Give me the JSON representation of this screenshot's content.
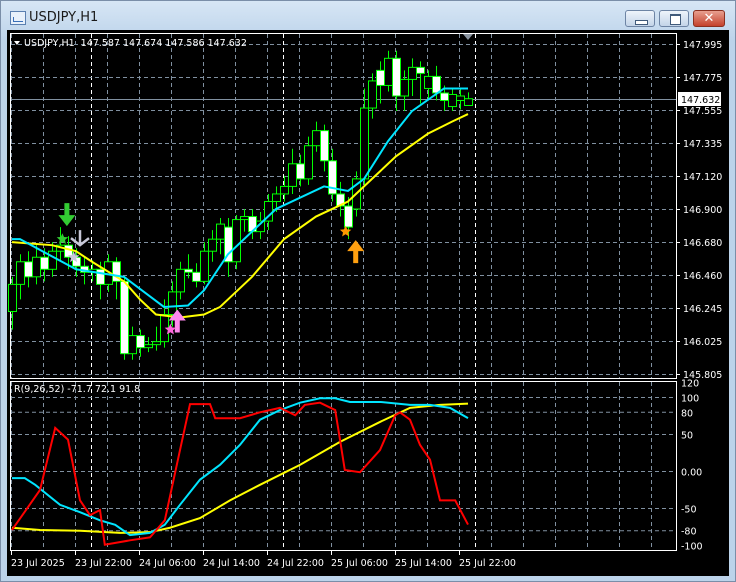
{
  "window": {
    "title": "USDJPY,H1",
    "minimize": "minimize",
    "maximize": "maximize",
    "close_glyph": "✕"
  },
  "chart_info": "USDJPY,H1  147.587 147.674 147.586 147.632",
  "indicator_info": "R(9,26,52) -71.7 72.1 91.8",
  "current_price": "147.632",
  "colors": {
    "background": "#000000",
    "bull_body": "#000000",
    "bear_body": "#ffffff",
    "candle_outline": "#00ff00",
    "ma_fast": "#00e5ff",
    "ma_slow": "#ffff00",
    "osc_red": "#ff0000",
    "grid": "#8090a0"
  },
  "chart_data": {
    "type": "candlestick",
    "symbol": "USDJPY",
    "timeframe": "H1",
    "price_ticks": [
      "147.995",
      "147.775",
      "147.555",
      "147.335",
      "147.120",
      "146.900",
      "146.680",
      "146.460",
      "146.245",
      "146.025",
      "145.805"
    ],
    "time_ticks": [
      "23 Jul 2025",
      "23 Jul 22:00",
      "24 Jul 06:00",
      "24 Jul 14:00",
      "24 Jul 22:00",
      "25 Jul 06:00",
      "25 Jul 14:00",
      "25 Jul 22:00"
    ],
    "candles_ohlc": [
      [
        146.22,
        146.45,
        146.1,
        146.4
      ],
      [
        146.4,
        146.6,
        146.3,
        146.55
      ],
      [
        146.55,
        146.62,
        146.38,
        146.45
      ],
      [
        146.45,
        146.66,
        146.4,
        146.58
      ],
      [
        146.58,
        146.64,
        146.42,
        146.5
      ],
      [
        146.5,
        146.68,
        146.45,
        146.62
      ],
      [
        146.62,
        146.78,
        146.55,
        146.66
      ],
      [
        146.66,
        146.72,
        146.5,
        146.58
      ],
      [
        146.58,
        146.64,
        146.45,
        146.52
      ],
      [
        146.52,
        146.58,
        146.4,
        146.48
      ],
      [
        146.48,
        146.56,
        146.42,
        146.5
      ],
      [
        146.5,
        146.55,
        146.3,
        146.4
      ],
      [
        146.4,
        146.6,
        146.35,
        146.55
      ],
      [
        146.55,
        146.58,
        146.3,
        146.42
      ],
      [
        146.42,
        146.45,
        145.9,
        145.94
      ],
      [
        145.94,
        146.12,
        145.9,
        146.06
      ],
      [
        146.06,
        146.1,
        145.92,
        145.98
      ],
      [
        145.98,
        146.05,
        145.95,
        146.0
      ],
      [
        146.0,
        146.12,
        145.96,
        146.02
      ],
      [
        146.02,
        146.3,
        145.98,
        146.2
      ],
      [
        146.2,
        146.42,
        146.12,
        146.35
      ],
      [
        146.35,
        146.55,
        146.3,
        146.5
      ],
      [
        146.5,
        146.6,
        146.44,
        146.48
      ],
      [
        146.48,
        146.54,
        146.38,
        146.42
      ],
      [
        146.42,
        146.68,
        146.4,
        146.62
      ],
      [
        146.62,
        146.76,
        146.55,
        146.7
      ],
      [
        146.7,
        146.84,
        146.6,
        146.8
      ],
      [
        146.78,
        146.84,
        146.45,
        146.55
      ],
      [
        146.55,
        146.86,
        146.5,
        146.83
      ],
      [
        146.83,
        146.9,
        146.75,
        146.85
      ],
      [
        146.85,
        146.9,
        146.7,
        146.75
      ],
      [
        146.75,
        146.88,
        146.7,
        146.82
      ],
      [
        146.82,
        147.0,
        146.76,
        146.95
      ],
      [
        146.95,
        147.05,
        146.88,
        147.0
      ],
      [
        147.0,
        147.12,
        146.95,
        147.05
      ],
      [
        147.05,
        147.3,
        147.0,
        147.2
      ],
      [
        147.2,
        147.26,
        147.05,
        147.1
      ],
      [
        147.1,
        147.38,
        147.06,
        147.32
      ],
      [
        147.32,
        147.48,
        147.28,
        147.42
      ],
      [
        147.42,
        147.46,
        147.15,
        147.22
      ],
      [
        147.22,
        147.3,
        146.95,
        147.0
      ],
      [
        147.0,
        147.08,
        146.85,
        146.92
      ],
      [
        146.92,
        146.98,
        146.7,
        146.78
      ],
      [
        146.9,
        147.15,
        146.85,
        147.1
      ],
      [
        147.1,
        147.7,
        147.05,
        147.57
      ],
      [
        147.57,
        147.8,
        147.5,
        147.75
      ],
      [
        147.82,
        147.88,
        147.6,
        147.72
      ],
      [
        147.72,
        147.95,
        147.68,
        147.9
      ],
      [
        147.9,
        147.95,
        147.55,
        147.65
      ],
      [
        147.65,
        147.82,
        147.55,
        147.76
      ],
      [
        147.76,
        147.9,
        147.65,
        147.84
      ],
      [
        147.84,
        147.88,
        147.6,
        147.8
      ],
      [
        147.7,
        147.82,
        147.62,
        147.78
      ],
      [
        147.78,
        147.85,
        147.62,
        147.67
      ],
      [
        147.67,
        147.72,
        147.55,
        147.62
      ],
      [
        147.58,
        147.7,
        147.55,
        147.66
      ],
      [
        147.62,
        147.7,
        147.56,
        147.65
      ],
      [
        147.587,
        147.674,
        147.586,
        147.632
      ]
    ],
    "ma_fast": [
      [
        0,
        146.7
      ],
      [
        1,
        146.7
      ],
      [
        8,
        146.5
      ],
      [
        14,
        146.45
      ],
      [
        19,
        146.25
      ],
      [
        22,
        146.26
      ],
      [
        24,
        146.36
      ],
      [
        27,
        146.6
      ],
      [
        33,
        146.9
      ],
      [
        39,
        147.05
      ],
      [
        42,
        147.02
      ],
      [
        44,
        147.1
      ],
      [
        47,
        147.35
      ],
      [
        50,
        147.55
      ],
      [
        54,
        147.7
      ],
      [
        57,
        147.7
      ]
    ],
    "ma_slow": [
      [
        0,
        146.68
      ],
      [
        5,
        146.66
      ],
      [
        8,
        146.62
      ],
      [
        10,
        146.55
      ],
      [
        14,
        146.42
      ],
      [
        16,
        146.3
      ],
      [
        18,
        146.2
      ],
      [
        21,
        146.18
      ],
      [
        24,
        146.2
      ],
      [
        26,
        146.25
      ],
      [
        30,
        146.45
      ],
      [
        34,
        146.7
      ],
      [
        38,
        146.85
      ],
      [
        42,
        146.95
      ],
      [
        45,
        147.1
      ],
      [
        48,
        147.25
      ],
      [
        52,
        147.4
      ],
      [
        55,
        147.48
      ],
      [
        57,
        147.53
      ]
    ],
    "indicator": {
      "name": "R(9,26,52)",
      "ticks": [
        "120",
        "100",
        "80",
        "50",
        "0.00",
        "-50",
        "-80",
        "-100"
      ],
      "tick_values": [
        120,
        100,
        80,
        50,
        0,
        -50,
        -80,
        -100
      ],
      "ylim": [
        -100,
        120
      ],
      "red": [
        [
          0,
          -79
        ],
        [
          3.5,
          -25
        ],
        [
          5.4,
          59
        ],
        [
          7,
          43
        ],
        [
          8.5,
          -39
        ],
        [
          9.75,
          -59
        ],
        [
          11,
          -52
        ],
        [
          11.6,
          -99
        ],
        [
          14.75,
          -93
        ],
        [
          17.25,
          -89
        ],
        [
          19.1,
          -66
        ],
        [
          21,
          29
        ],
        [
          22.25,
          91
        ],
        [
          24.75,
          91
        ],
        [
          25.4,
          72
        ],
        [
          28.5,
          72
        ],
        [
          31,
          80
        ],
        [
          33.5,
          86
        ],
        [
          35.4,
          76
        ],
        [
          36.6,
          90
        ],
        [
          38.5,
          93
        ],
        [
          40.4,
          83
        ],
        [
          41,
          43
        ],
        [
          41.6,
          2
        ],
        [
          43.5,
          -1
        ],
        [
          46,
          29
        ],
        [
          47.9,
          76
        ],
        [
          48.5,
          80
        ],
        [
          49.75,
          70
        ],
        [
          51,
          36
        ],
        [
          52.25,
          16
        ],
        [
          53.5,
          -39
        ],
        [
          55.4,
          -39
        ],
        [
          57,
          -71.7
        ]
      ],
      "cyan": [
        [
          0,
          -9
        ],
        [
          1.6,
          -9
        ],
        [
          2.9,
          -18
        ],
        [
          6,
          -45
        ],
        [
          8.5,
          -55
        ],
        [
          11,
          -66
        ],
        [
          12.9,
          -72
        ],
        [
          14.75,
          -86
        ],
        [
          17.25,
          -83
        ],
        [
          19.1,
          -72
        ],
        [
          21,
          -45
        ],
        [
          23.5,
          -11
        ],
        [
          26,
          9
        ],
        [
          28.5,
          36
        ],
        [
          31,
          70
        ],
        [
          33.5,
          83
        ],
        [
          36,
          93
        ],
        [
          38.5,
          99
        ],
        [
          40.4,
          99
        ],
        [
          42.25,
          94
        ],
        [
          46,
          94
        ],
        [
          49.75,
          90
        ],
        [
          52.25,
          90
        ],
        [
          54.75,
          86
        ],
        [
          57,
          72.1
        ]
      ],
      "yellow": [
        [
          0,
          -76
        ],
        [
          3.5,
          -79
        ],
        [
          8.5,
          -80
        ],
        [
          13.5,
          -83
        ],
        [
          17.25,
          -82
        ],
        [
          19.75,
          -76
        ],
        [
          23.5,
          -63
        ],
        [
          27.25,
          -39
        ],
        [
          31,
          -18
        ],
        [
          36,
          9
        ],
        [
          41,
          40
        ],
        [
          46,
          67
        ],
        [
          49.75,
          86
        ],
        [
          53.5,
          90
        ],
        [
          57,
          91.8
        ]
      ]
    },
    "signals": [
      {
        "type": "arrow-down",
        "candle": 6.8,
        "price": 146.78,
        "color": "#33cc33"
      },
      {
        "type": "star-arrow-down",
        "candle": 8.5,
        "price": 146.68,
        "color": "#c8c8d8"
      },
      {
        "type": "star",
        "candle": 7.7,
        "price": 146.58,
        "color": "#c8c8d8"
      },
      {
        "type": "star",
        "candle": 6.3,
        "price": 146.7,
        "color": "#33cc33"
      },
      {
        "type": "arrow-up",
        "candle": 20.6,
        "price": 146.2,
        "color": "#ff88ee"
      },
      {
        "type": "star",
        "candle": 19.8,
        "price": 146.1,
        "color": "#ff66dd"
      },
      {
        "type": "star",
        "candle": 41.7,
        "price": 146.75,
        "color": "#ff9900"
      },
      {
        "type": "arrow-up",
        "candle": 42.9,
        "price": 146.66,
        "color": "#ffa010"
      }
    ]
  }
}
